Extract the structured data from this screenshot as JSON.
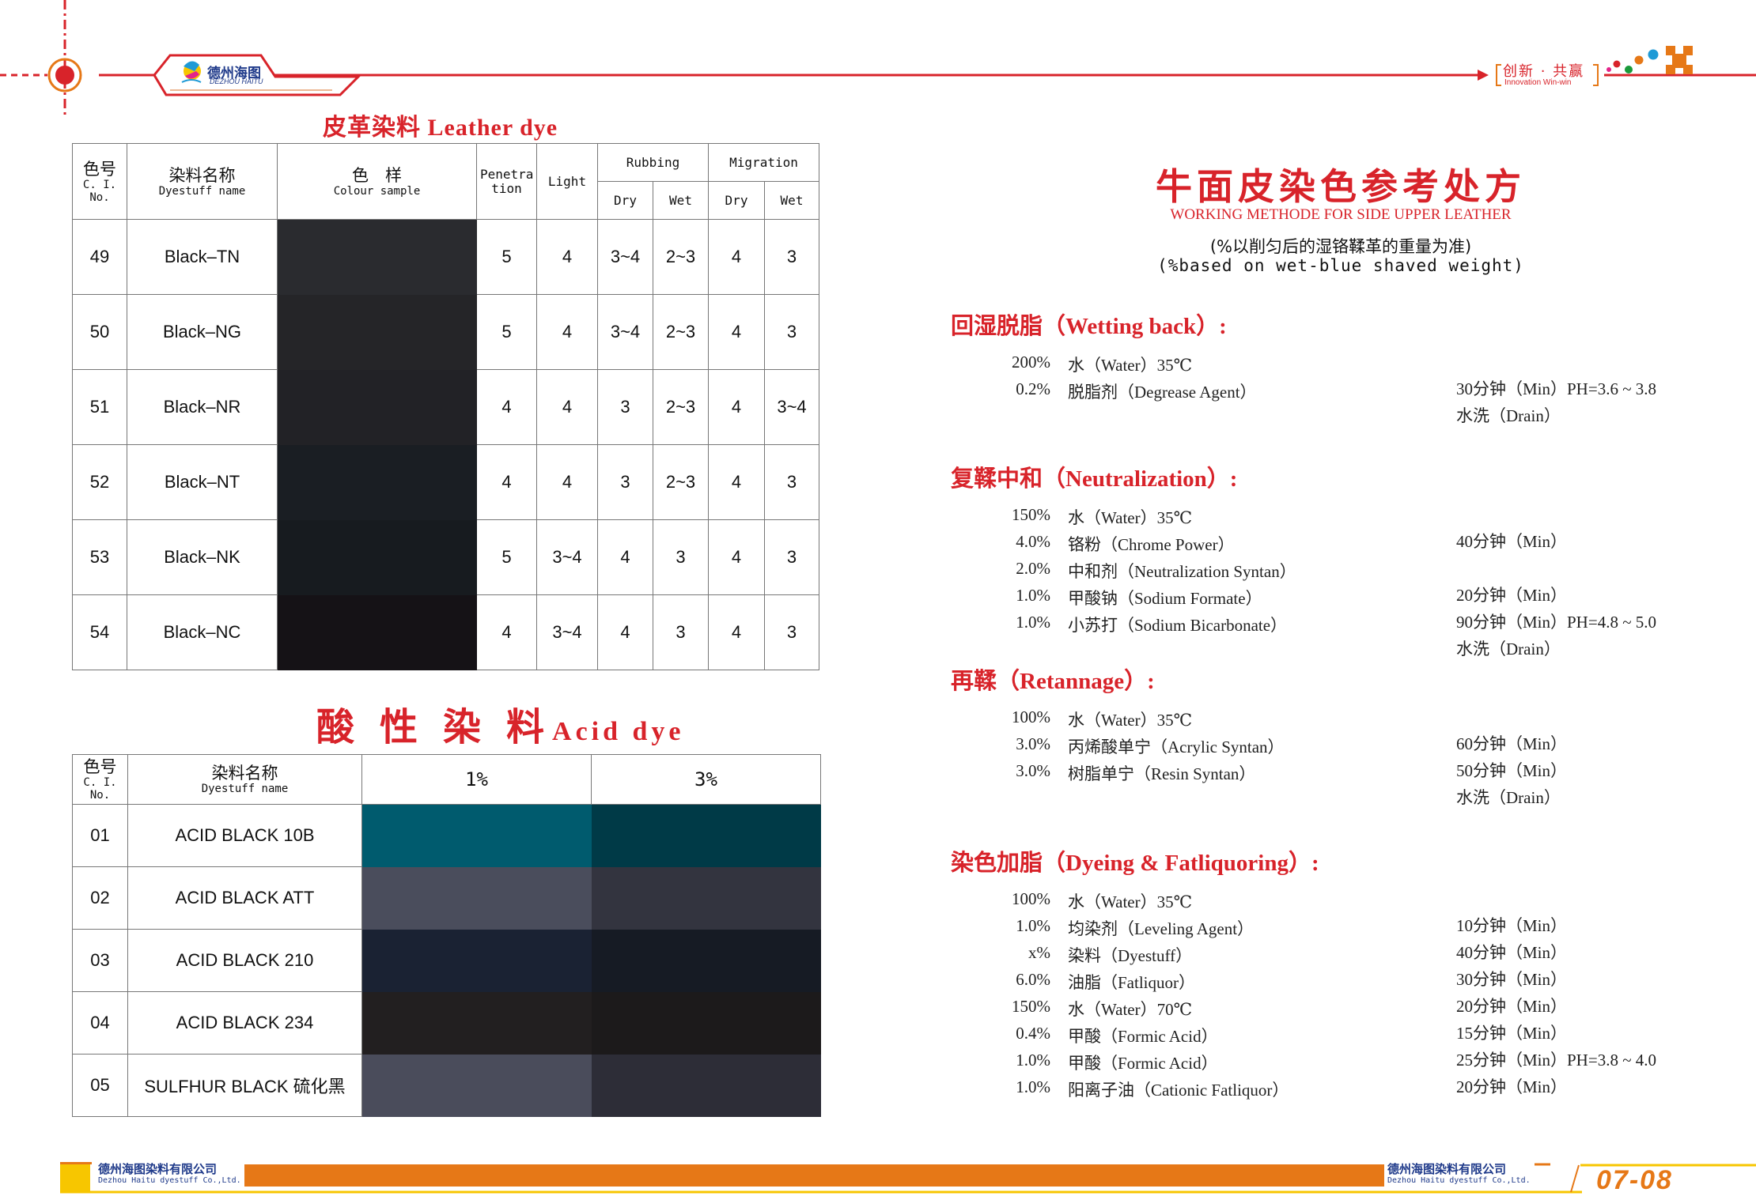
{
  "header": {
    "logo_cn": "德州海图",
    "logo_en": "DEZHOU HAITU",
    "slogan_cn": "创新 · 共赢",
    "slogan_en": "Innovation Win-win",
    "accent": "#d8232a",
    "orange": "#e67817"
  },
  "leather": {
    "title": "皮革染料  Leather dye",
    "headers": {
      "ci_cn": "色号",
      "ci_en": "C. I. No.",
      "name_cn": "染料名称",
      "name_en": "Dyestuff name",
      "sample_cn": "色　样",
      "sample_en": "Colour sample",
      "penetration": "Penetra tion",
      "light": "Light",
      "rubbing": "Rubbing",
      "migration": "Migration",
      "dry": "Dry",
      "wet": "Wet"
    },
    "rows": [
      {
        "no": "49",
        "name": "Black–TN",
        "color": "#2a2b2f",
        "penetration": "5",
        "light": "4",
        "rub_dry": "3~4",
        "rub_wet": "2~3",
        "mig_dry": "4",
        "mig_wet": "3"
      },
      {
        "no": "50",
        "name": "Black–NG",
        "color": "#252528",
        "penetration": "5",
        "light": "4",
        "rub_dry": "3~4",
        "rub_wet": "2~3",
        "mig_dry": "4",
        "mig_wet": "3"
      },
      {
        "no": "51",
        "name": "Black–NR",
        "color": "#222226",
        "penetration": "4",
        "light": "4",
        "rub_dry": "3",
        "rub_wet": "2~3",
        "mig_dry": "4",
        "mig_wet": "3~4"
      },
      {
        "no": "52",
        "name": "Black–NT",
        "color": "#1a1e23",
        "penetration": "4",
        "light": "4",
        "rub_dry": "3",
        "rub_wet": "2~3",
        "mig_dry": "4",
        "mig_wet": "3"
      },
      {
        "no": "53",
        "name": "Black–NK",
        "color": "#171b1f",
        "penetration": "5",
        "light": "3~4",
        "rub_dry": "4",
        "rub_wet": "3",
        "mig_dry": "4",
        "mig_wet": "3"
      },
      {
        "no": "54",
        "name": "Black–NC",
        "color": "#151216",
        "penetration": "4",
        "light": "3~4",
        "rub_dry": "4",
        "rub_wet": "3",
        "mig_dry": "4",
        "mig_wet": "3"
      }
    ]
  },
  "acid": {
    "title_cn": "酸 性 染 料",
    "title_en": "Acid dye",
    "headers": {
      "ci_cn": "色号",
      "ci_en": "C. I. No.",
      "name_cn": "染料名称",
      "name_en": "Dyestuff name",
      "c1": "1%",
      "c3": "3%"
    },
    "rows": [
      {
        "no": "01",
        "name": "ACID BLACK 10B",
        "color_1": "#005b6e",
        "color_3": "#003a47"
      },
      {
        "no": "02",
        "name": "ACID BLACK ATT",
        "color_1": "#4a4d5c",
        "color_3": "#33343f"
      },
      {
        "no": "03",
        "name": "ACID BLACK 210",
        "color_1": "#1a2233",
        "color_3": "#161b24"
      },
      {
        "no": "04",
        "name": "ACID BLACK 234",
        "color_1": "#221f20",
        "color_3": "#1c1a1b"
      },
      {
        "no": "05",
        "name": "SULFHUR BLACK 硫化黑",
        "color_1": "#4a4c5b",
        "color_3": "#2d2d37"
      }
    ]
  },
  "recipe": {
    "title_cn": "牛面皮染色参考处方",
    "title_en": "WORKING METHODE FOR SIDE UPPER LEATHER",
    "note_cn": "(%以削匀后的湿铬鞣革的重量为准)",
    "note_en": "(%based on wet-blue shaved weight)",
    "sections": [
      {
        "heading": "回湿脱脂（Wetting back）:",
        "rows": [
          {
            "pct": "200%",
            "name": "水（Water）35℃",
            "time": ""
          },
          {
            "pct": "0.2%",
            "name": "脱脂剂（Degrease Agent）",
            "time": "30分钟（Min）PH=3.6 ~ 3.8"
          },
          {
            "pct": "",
            "name": "",
            "time": "水洗（Drain）"
          }
        ]
      },
      {
        "heading": "复鞣中和（Neutralization）:",
        "rows": [
          {
            "pct": "150%",
            "name": "水（Water）35℃",
            "time": ""
          },
          {
            "pct": "4.0%",
            "name": "铬粉（Chrome Power）",
            "time": "40分钟（Min）"
          },
          {
            "pct": "2.0%",
            "name": "中和剂（Neutralization Syntan）",
            "time": ""
          },
          {
            "pct": "1.0%",
            "name": "甲酸钠（Sodium Formate）",
            "time": "20分钟（Min）"
          },
          {
            "pct": "1.0%",
            "name": "小苏打（Sodium Bicarbonate）",
            "time": "90分钟（Min）PH=4.8 ~ 5.0"
          },
          {
            "pct": "",
            "name": "",
            "time": "水洗（Drain）"
          }
        ]
      },
      {
        "heading": "再鞣（Retannage）:",
        "rows": [
          {
            "pct": "100%",
            "name": "水（Water）35℃",
            "time": ""
          },
          {
            "pct": "3.0%",
            "name": "丙烯酸单宁（Acrylic Syntan）",
            "time": "60分钟（Min）"
          },
          {
            "pct": "3.0%",
            "name": "树脂单宁（Resin Syntan）",
            "time": "50分钟（Min）"
          },
          {
            "pct": "",
            "name": "",
            "time": "水洗（Drain）"
          }
        ]
      },
      {
        "heading": "染色加脂（Dyeing & Fatliquoring）:",
        "rows": [
          {
            "pct": "100%",
            "name": "水（Water）35℃",
            "time": ""
          },
          {
            "pct": "1.0%",
            "name": "均染剂（Leveling Agent）",
            "time": "10分钟（Min）"
          },
          {
            "pct": "x%",
            "name": "染料（Dyestuff）",
            "time": "40分钟（Min）"
          },
          {
            "pct": "6.0%",
            "name": "油脂（Fatliquor）",
            "time": "30分钟（Min）"
          },
          {
            "pct": "150%",
            "name": "水（Water）70℃",
            "time": "20分钟（Min）"
          },
          {
            "pct": "0.4%",
            "name": "甲酸（Formic Acid）",
            "time": "15分钟（Min）"
          },
          {
            "pct": "1.0%",
            "name": "甲酸（Formic Acid）",
            "time": "25分钟（Min）PH=3.8 ~ 4.0"
          },
          {
            "pct": "1.0%",
            "name": "阳离子油（Cationic Fatliquor）",
            "time": "20分钟（Min）"
          }
        ]
      }
    ]
  },
  "footer": {
    "company_cn": "德州海图染料有限公司",
    "company_en": "Dezhou Haitu dyestuff Co.,Ltd.",
    "page": "07-08"
  }
}
